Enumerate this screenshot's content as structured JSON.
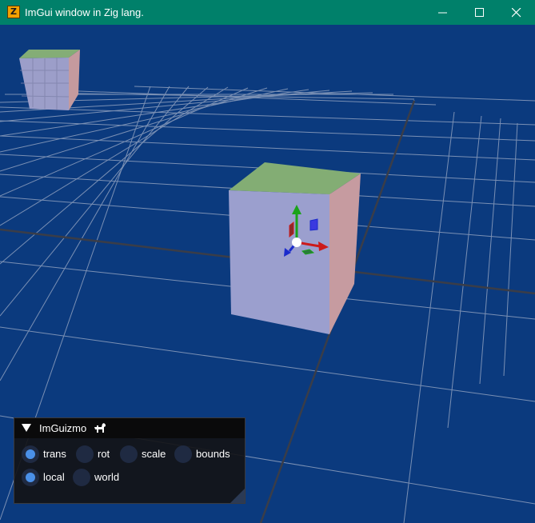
{
  "window": {
    "title": "ImGui window in Zig lang.",
    "icon_letter": "Z",
    "titlebar_color": "#00806a",
    "controls": {
      "minimize": "minimize-icon",
      "maximize": "maximize-icon",
      "close": "close-icon"
    }
  },
  "scene": {
    "background_color": "#0b3a7e",
    "objects": [
      "grid-floor",
      "cube-far",
      "cube-selected"
    ],
    "gizmo_axes": {
      "x": "#cc1a1a",
      "y": "#1aa31a",
      "z": "#1a2acc"
    }
  },
  "panel": {
    "title": "ImGuizmo",
    "title_icon": "dog-icon",
    "operation_options": [
      {
        "label": "trans",
        "selected": true
      },
      {
        "label": "rot",
        "selected": false
      },
      {
        "label": "scale",
        "selected": false
      },
      {
        "label": "bounds",
        "selected": false
      }
    ],
    "mode_options": [
      {
        "label": "local",
        "selected": true
      },
      {
        "label": "world",
        "selected": false
      }
    ]
  }
}
